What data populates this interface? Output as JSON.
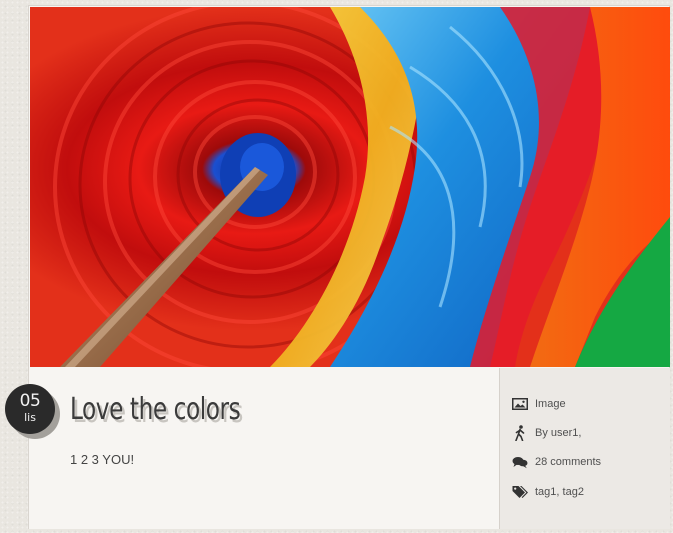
{
  "post": {
    "title": "Love the colors",
    "excerpt": "1 2 3 YOU!",
    "date": {
      "day": "05",
      "month": "lis"
    },
    "image": {
      "alt": "colorful painted fan close-up"
    }
  },
  "meta": {
    "type": {
      "label": "Image",
      "icon": "image-icon"
    },
    "author": {
      "label": "By user1,",
      "icon": "walking-person-icon"
    },
    "comments": {
      "label": "28 comments",
      "icon": "comments-icon"
    },
    "tags": {
      "label": "tag1, tag2",
      "icon": "tags-icon"
    }
  },
  "colors": {
    "background": "#e9e6e0",
    "card": "#f7f5f2",
    "meta_panel": "#ece9e5",
    "badge": "#2a2a2a",
    "title": "#3b3b3b"
  }
}
